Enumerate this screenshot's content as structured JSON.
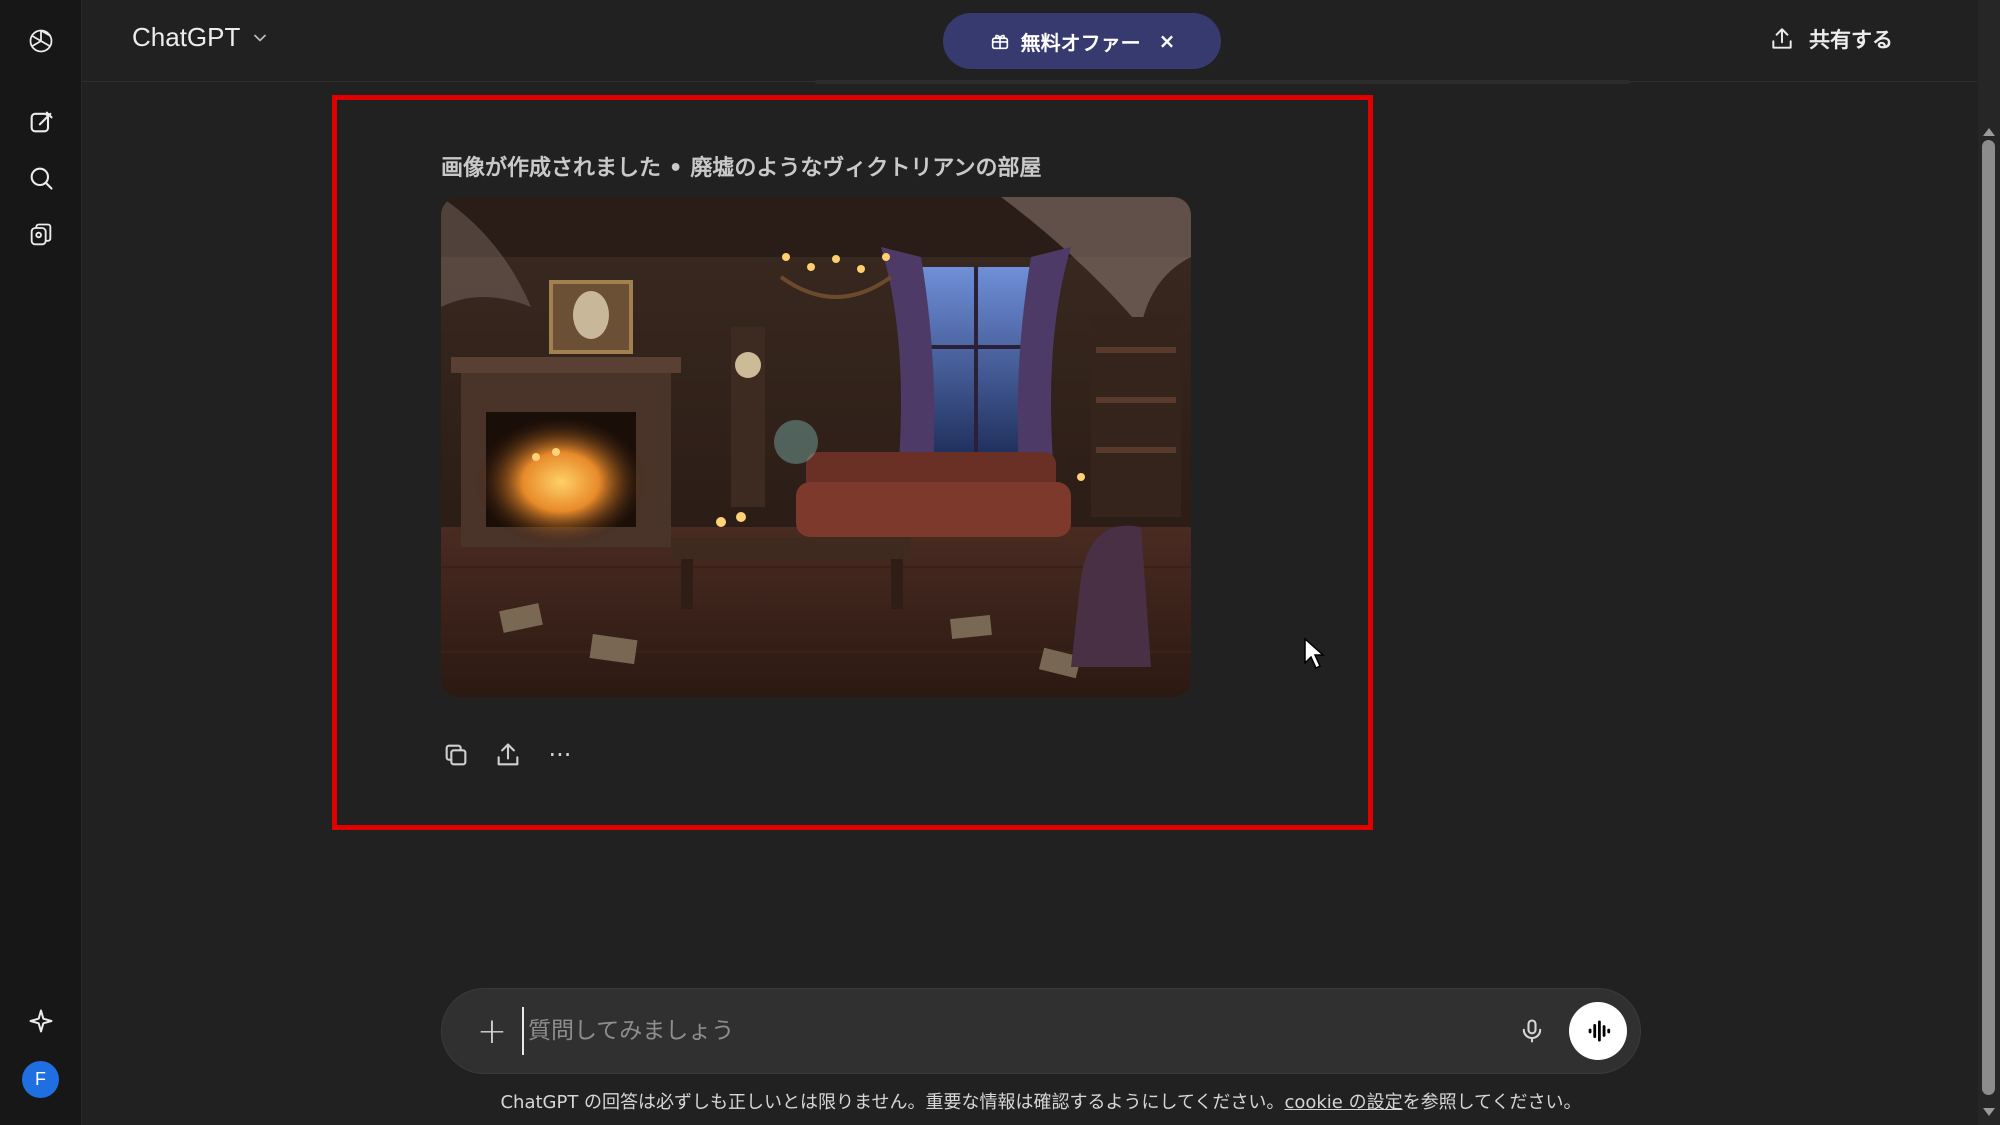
{
  "app": {
    "model_name": "ChatGPT"
  },
  "header": {
    "offer_label": "無料オファー",
    "offer_close": "×",
    "share_label": "共有する",
    "more_label": "···"
  },
  "rail": {
    "icons": [
      "openai-logo-icon",
      "new-chat-icon",
      "search-icon",
      "gpts-library-icon",
      "upgrade-sparkle-icon"
    ],
    "avatar_initial": "F"
  },
  "message": {
    "caption": "画像が作成されました • 廃墟のようなヴィクトリアンの部屋",
    "actions": [
      "copy-icon",
      "share-icon",
      "more-icon"
    ],
    "more_label": "···"
  },
  "composer": {
    "plus_label": "+",
    "placeholder": "質問してみましょう",
    "value": ""
  },
  "footer": {
    "disclaimer_prefix": "ChatGPT の回答は必ずしも正しいとは限りません。重要な情報は確認するようにしてください。",
    "disclaimer_link": "cookie の設定",
    "disclaimer_suffix": "を参照してください。"
  },
  "colors": {
    "background": "#212121",
    "rail": "#171717",
    "offer_pill": "#373a6e",
    "highlight": "#e00000",
    "avatar": "#1f6fe0"
  }
}
